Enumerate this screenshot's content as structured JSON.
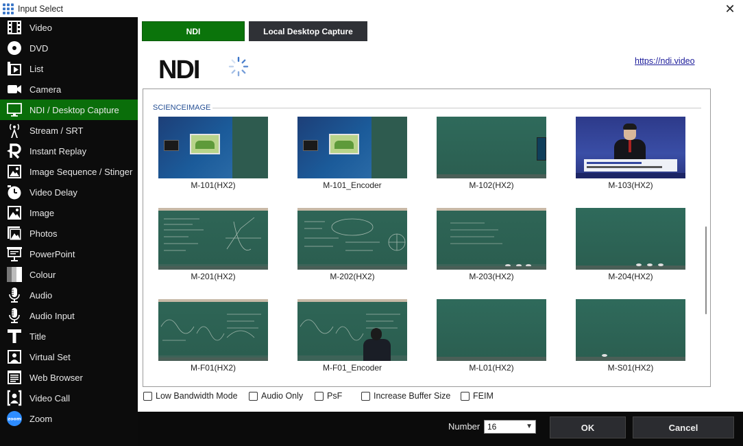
{
  "window": {
    "title": "Input Select",
    "close_icon": "close-icon"
  },
  "sidebar": {
    "selected_index": 4,
    "items": [
      {
        "label": "Video",
        "icon": "video-icon"
      },
      {
        "label": "DVD",
        "icon": "dvd-icon"
      },
      {
        "label": "List",
        "icon": "list-icon"
      },
      {
        "label": "Camera",
        "icon": "camera-icon"
      },
      {
        "label": "NDI / Desktop Capture",
        "icon": "monitor-icon"
      },
      {
        "label": "Stream / SRT",
        "icon": "antenna-icon"
      },
      {
        "label": "Instant Replay",
        "icon": "replay-icon"
      },
      {
        "label": "Image Sequence / Stinger",
        "icon": "image-sequence-icon"
      },
      {
        "label": "Video Delay",
        "icon": "clock-icon"
      },
      {
        "label": "Image",
        "icon": "image-icon"
      },
      {
        "label": "Photos",
        "icon": "photos-icon"
      },
      {
        "label": "PowerPoint",
        "icon": "presentation-icon"
      },
      {
        "label": "Colour",
        "icon": "colour-icon"
      },
      {
        "label": "Audio",
        "icon": "microphone-icon"
      },
      {
        "label": "Audio Input",
        "icon": "microphone-icon"
      },
      {
        "label": "Title",
        "icon": "title-icon"
      },
      {
        "label": "Virtual Set",
        "icon": "virtual-set-icon"
      },
      {
        "label": "Web Browser",
        "icon": "web-browser-icon"
      },
      {
        "label": "Video Call",
        "icon": "video-call-icon"
      },
      {
        "label": "Zoom",
        "icon": "zoom-icon"
      }
    ]
  },
  "tabs": [
    {
      "label": "NDI",
      "active": true
    },
    {
      "label": "Local Desktop Capture",
      "active": false
    }
  ],
  "ndi": {
    "logo_text": "NDI",
    "link": "https://ndi.video"
  },
  "sources": {
    "group": "SCIENCEIMAGE",
    "items": [
      {
        "label": "M-101(HX2)",
        "thumb": "screen"
      },
      {
        "label": "M-101_Encoder",
        "thumb": "screen"
      },
      {
        "label": "M-102(HX2)",
        "thumb": "board-monitor"
      },
      {
        "label": "M-103(HX2)",
        "thumb": "news"
      },
      {
        "label": "M-201(HX2)",
        "thumb": "board-chalk"
      },
      {
        "label": "M-202(HX2)",
        "thumb": "board-chalk"
      },
      {
        "label": "M-203(HX2)",
        "thumb": "board-chalk"
      },
      {
        "label": "M-204(HX2)",
        "thumb": "board-plain"
      },
      {
        "label": "M-F01(HX2)",
        "thumb": "board-chalk"
      },
      {
        "label": "M-F01_Encoder",
        "thumb": "board-person"
      },
      {
        "label": "M-L01(HX2)",
        "thumb": "board-plain"
      },
      {
        "label": "M-S01(HX2)",
        "thumb": "board-plain"
      }
    ]
  },
  "options": [
    {
      "label": "Low Bandwidth Mode",
      "checked": false
    },
    {
      "label": "Audio Only",
      "checked": false
    },
    {
      "label": "PsF",
      "checked": false
    },
    {
      "label": "Increase Buffer Size",
      "checked": false
    },
    {
      "label": "FEIM",
      "checked": false
    }
  ],
  "footer": {
    "number_label": "Number",
    "number_value": "16",
    "ok_label": "OK",
    "cancel_label": "Cancel"
  },
  "colors": {
    "sidebar_bg": "#0c0c0c",
    "selected_green": "#0a6e0a",
    "tab_ndi": "#0b740b",
    "tab_dark": "#2f3136",
    "link": "#1b1b9a",
    "group_label": "#254f94"
  }
}
